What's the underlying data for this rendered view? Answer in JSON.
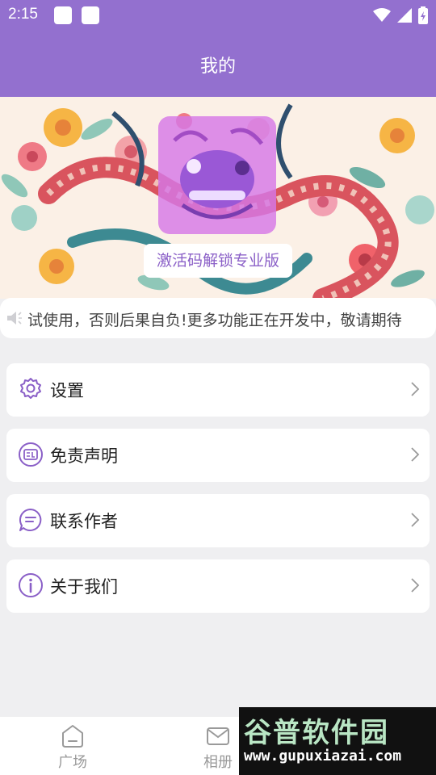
{
  "status_bar": {
    "time": "2:15"
  },
  "header": {
    "title": "我的"
  },
  "banner": {
    "unlock_label": "激活码解锁专业版"
  },
  "notice": {
    "text": "试使用，否则后果自负!更多功能正在开发中，敬请期待"
  },
  "menu": [
    {
      "label": "设置",
      "icon": "gear-icon"
    },
    {
      "label": "免责声明",
      "icon": "document-icon"
    },
    {
      "label": "联系作者",
      "icon": "chat-icon"
    },
    {
      "label": "关于我们",
      "icon": "info-icon"
    }
  ],
  "nav": [
    {
      "label": "广场",
      "icon": "square-icon"
    },
    {
      "label": "相册",
      "icon": "mail-icon"
    }
  ],
  "watermark": {
    "title": "谷普软件园",
    "url": "www.gupuxiazai.com"
  },
  "colors": {
    "primary": "#9370cf",
    "accent": "#8a5fc7",
    "background": "#efeff1"
  }
}
